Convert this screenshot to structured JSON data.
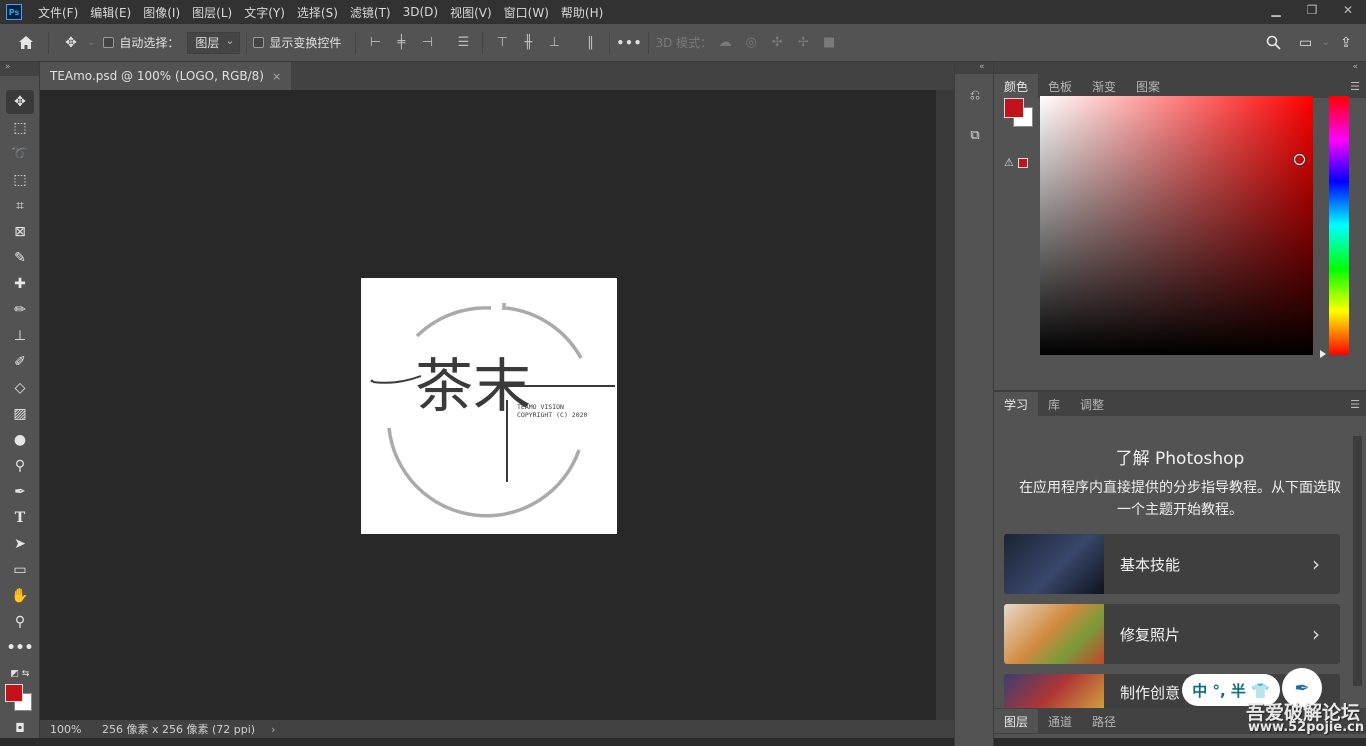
{
  "app": {
    "logo": "Ps",
    "accent": "#31a8ff"
  },
  "menu": [
    "文件(F)",
    "编辑(E)",
    "图像(I)",
    "图层(L)",
    "文字(Y)",
    "选择(S)",
    "滤镜(T)",
    "3D(D)",
    "视图(V)",
    "窗口(W)",
    "帮助(H)"
  ],
  "options": {
    "auto_select_label": "自动选择：",
    "auto_select_value": "图层",
    "show_transform_label": "显示变换控件",
    "mode_3d_label": "3D 模式：",
    "more": "•••"
  },
  "document_tab": {
    "title": "TEAmo.psd @ 100% (LOGO, RGB/8)",
    "close": "×"
  },
  "logo_art": {
    "chars": "茶末",
    "line1": "TEAMO VISION",
    "line2": "COPYRIGHT (C) 2020"
  },
  "status": {
    "zoom": "100%",
    "info": "256 像素 x 256 像素 (72 ppi)",
    "arrow": "›"
  },
  "color_panel": {
    "tabs": [
      "颜色",
      "色板",
      "渐变",
      "图案"
    ],
    "foreground": "#c4121a",
    "background": "#ffffff",
    "gamut_warning_icon": "⚠"
  },
  "learn_panel": {
    "tabs": [
      "学习",
      "库",
      "调整"
    ],
    "title": "了解 Photoshop",
    "description": "在应用程序内直接提供的分步指导教程。从下面选取一个主题开始教程。",
    "tutorials": [
      {
        "label": "基本技能",
        "arrow": "›"
      },
      {
        "label": "修复照片",
        "arrow": "›"
      },
      {
        "label": "制作创意",
        "arrow": "›"
      }
    ]
  },
  "layers_panel": {
    "tabs": [
      "图层",
      "通道",
      "路径"
    ]
  },
  "overlay": {
    "ime_text": "中 °, 半 👕",
    "watermark_text": "吾爱破解论坛",
    "watermark_url": "www.52pojie.cn"
  }
}
